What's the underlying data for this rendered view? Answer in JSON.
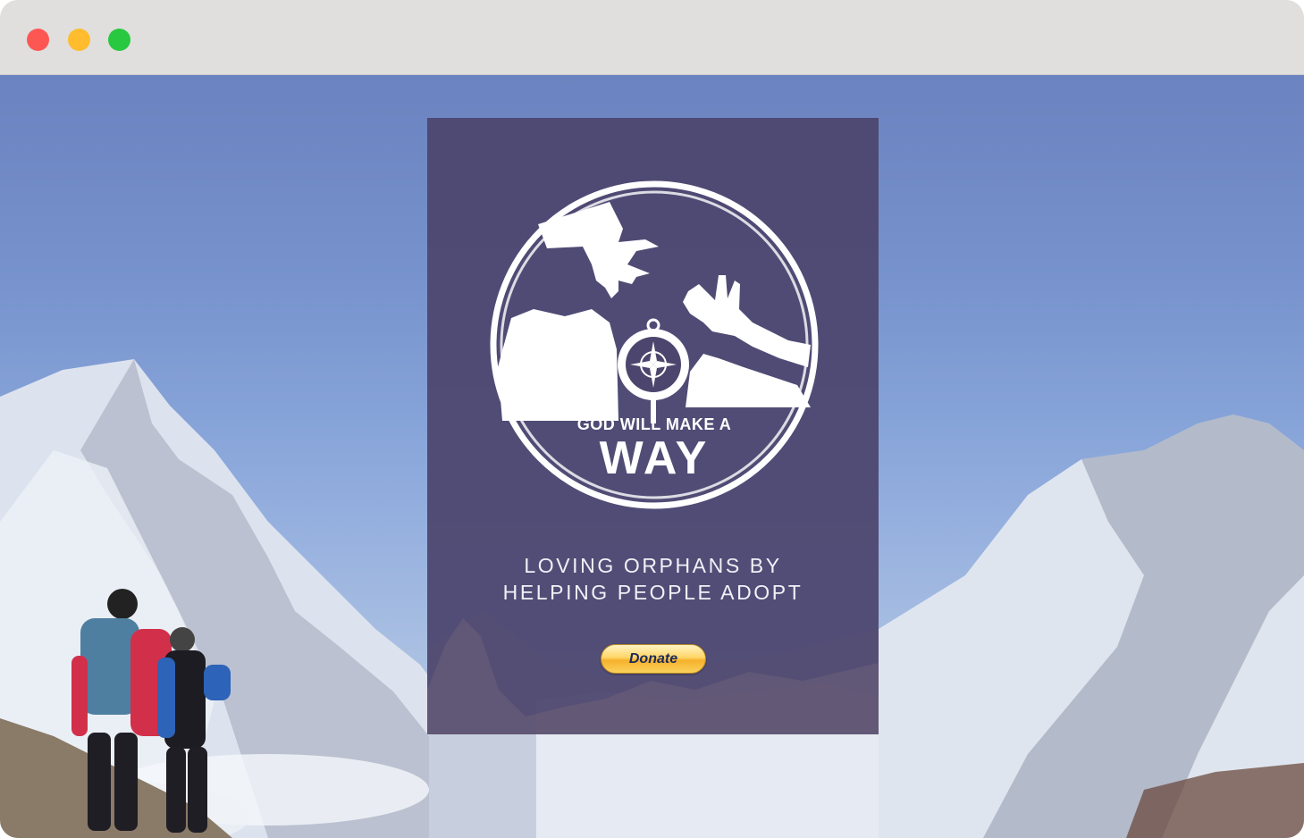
{
  "window": {
    "controls": [
      "close",
      "minimize",
      "zoom"
    ]
  },
  "background": {
    "icon": "mountain-hikers-photo"
  },
  "logo": {
    "line1": "GOD WILL MAKE A",
    "line2": "WAY",
    "icon": "hands-compass-logo"
  },
  "tagline": {
    "line1": "LOVING ORPHANS BY",
    "line2": "HELPING PEOPLE ADOPT"
  },
  "donate": {
    "label": "Donate"
  },
  "colors": {
    "card": "#4c466e",
    "sky": "#7691cc",
    "button": "#ffd666"
  }
}
